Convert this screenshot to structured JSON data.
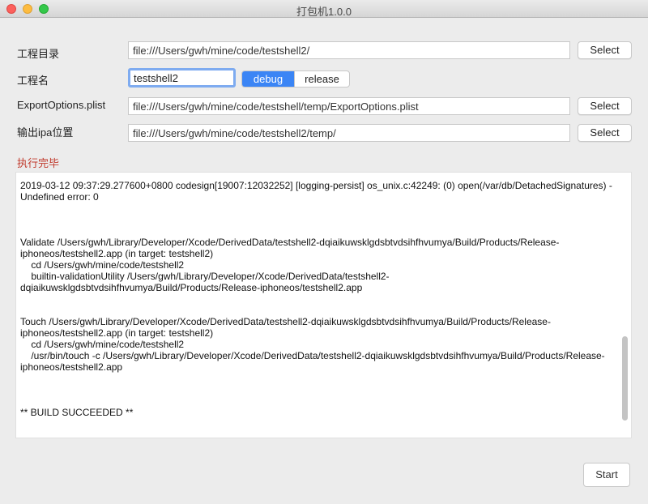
{
  "window": {
    "title": "打包机1.0.0"
  },
  "form": {
    "project_dir": {
      "label": "工程目录",
      "value": "file:///Users/gwh/mine/code/testshell2/",
      "button": "Select"
    },
    "project_name": {
      "label": "工程名",
      "value": "testshell2"
    },
    "config": {
      "options": [
        "debug",
        "release"
      ],
      "selected": "debug"
    },
    "export_options": {
      "label": "ExportOptions.plist",
      "value": "file:///Users/gwh/mine/code/testshell/temp/ExportOptions.plist",
      "button": "Select"
    },
    "output_ipa": {
      "label": "输出ipa位置",
      "value": "file:///Users/gwh/mine/code/testshell2/temp/",
      "button": "Select"
    }
  },
  "status": {
    "text": "执行完毕",
    "color": "#c0392b"
  },
  "log": {
    "text": "2019-03-12 09:37:29.277600+0800 codesign[19007:12032252] [logging-persist] os_unix.c:42249: (0) open(/var/db/DetachedSignatures) - Undefined error: 0\n\n\n\nValidate /Users/gwh/Library/Developer/Xcode/DerivedData/testshell2-dqiaikuwsklgdsbtvdsihfhvumya/Build/Products/Release-iphoneos/testshell2.app (in target: testshell2)\n    cd /Users/gwh/mine/code/testshell2\n    builtin-validationUtility /Users/gwh/Library/Developer/Xcode/DerivedData/testshell2-dqiaikuwsklgdsbtvdsihfhvumya/Build/Products/Release-iphoneos/testshell2.app\n\n\nTouch /Users/gwh/Library/Developer/Xcode/DerivedData/testshell2-dqiaikuwsklgdsbtvdsihfhvumya/Build/Products/Release-iphoneos/testshell2.app (in target: testshell2)\n    cd /Users/gwh/mine/code/testshell2\n    /usr/bin/touch -c /Users/gwh/Library/Developer/Xcode/DerivedData/testshell2-dqiaikuwsklgdsbtvdsihfhvumya/Build/Products/Release-iphoneos/testshell2.app\n\n\n\n** BUILD SUCCEEDED **"
  },
  "actions": {
    "start": "Start"
  }
}
